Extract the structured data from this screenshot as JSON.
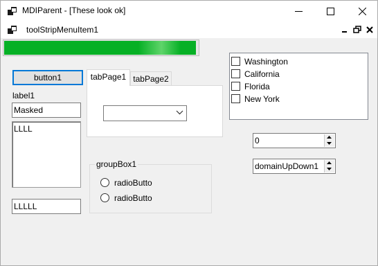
{
  "window": {
    "title": "MDIParent - [These look ok]"
  },
  "menu": {
    "item": "toolStripMenuItem1"
  },
  "progress": {
    "value_fraction": 0.99
  },
  "button1": {
    "label": "button1"
  },
  "label1": {
    "text": "label1"
  },
  "masked_textbox": {
    "value": "Masked"
  },
  "multiline_textbox": {
    "value": "LLLL"
  },
  "bottom_textbox": {
    "value": "LLLLL"
  },
  "tabs": [
    {
      "label": "tabPage1"
    },
    {
      "label": "tabPage2"
    }
  ],
  "combobox": {
    "value": ""
  },
  "groupbox": {
    "label": "groupBox1",
    "radios": [
      {
        "label": "radioButto"
      },
      {
        "label": "radioButto"
      }
    ]
  },
  "checklist": {
    "items": [
      {
        "label": "Washington",
        "checked": false
      },
      {
        "label": "California",
        "checked": false
      },
      {
        "label": "Florida",
        "checked": false
      },
      {
        "label": "New York",
        "checked": false
      }
    ]
  },
  "numeric_updown": {
    "value": "0"
  },
  "domain_updown": {
    "value": "domainUpDown1"
  },
  "colors": {
    "progress": "#06b025",
    "focus_border": "#0078d7"
  }
}
